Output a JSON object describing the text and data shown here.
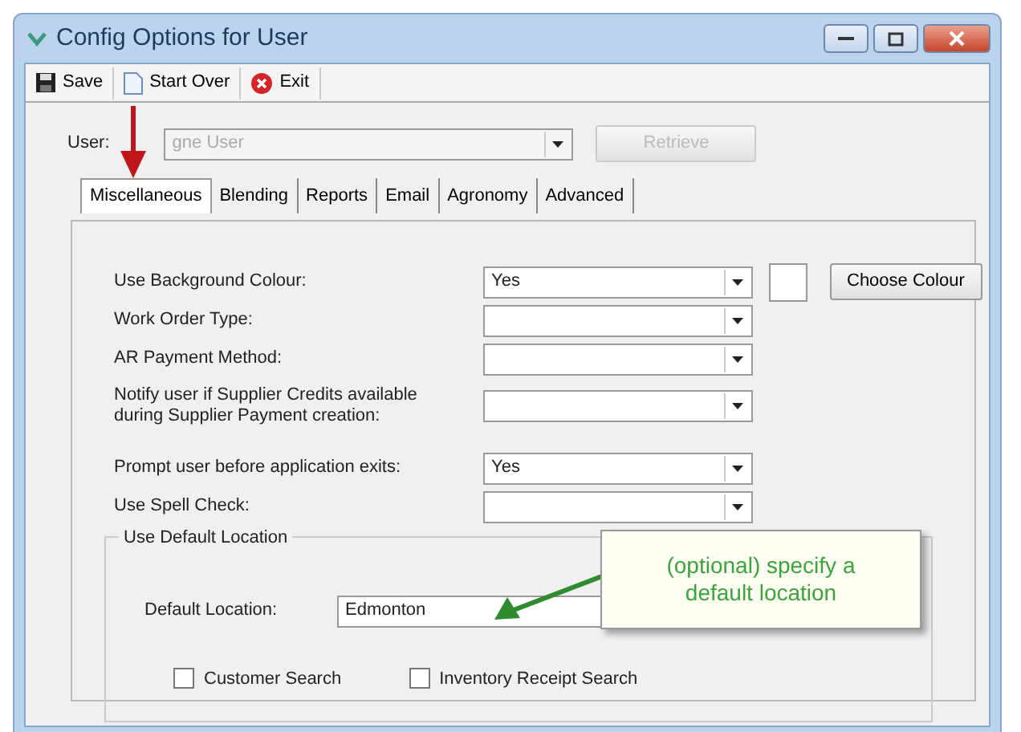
{
  "window": {
    "title": "Config Options for User"
  },
  "toolbar": [
    {
      "label": "Save",
      "kind": "save"
    },
    {
      "label": "Start Over",
      "kind": "new"
    },
    {
      "label": "Exit",
      "kind": "exit"
    }
  ],
  "user": {
    "label": "User:",
    "value": "gne User",
    "disabled": true
  },
  "retrieve_button": {
    "label": "Retrieve",
    "disabled": true
  },
  "tabs": [
    {
      "label": "Miscellaneous",
      "selected": true
    },
    {
      "label": "Blending",
      "selected": false
    },
    {
      "label": "Reports",
      "selected": false
    },
    {
      "label": "Email",
      "selected": false
    },
    {
      "label": "Agronomy",
      "selected": false
    },
    {
      "label": "Advanced",
      "selected": false
    }
  ],
  "settings": [
    {
      "label": "Use Background Colour:",
      "value": "Yes",
      "colour_button": "Choose Colour"
    },
    {
      "label": "Work Order Type:"
    },
    {
      "label": "AR Payment Method:"
    },
    {
      "label": "Notify user if Supplier Credits available during Supplier Payment creation:"
    },
    {
      "label": "Prompt user before application exits:",
      "value": "Yes"
    },
    {
      "label": "Use Spell Check:"
    }
  ],
  "location_group": {
    "title": "Use Default Location",
    "field_label": "Default Location:",
    "value": "Edmonton",
    "checkboxes": [
      {
        "label": "Customer Search",
        "checked": false
      },
      {
        "label": "Inventory Receipt Search",
        "checked": false
      }
    ]
  },
  "callout": {
    "text": "(optional) specify a default location"
  }
}
